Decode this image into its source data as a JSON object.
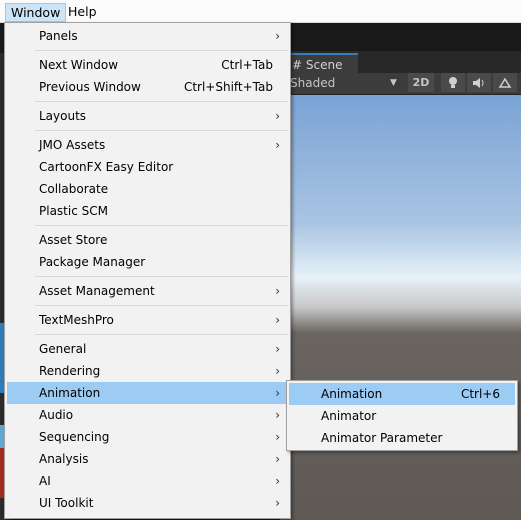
{
  "menubar": {
    "window": "Window",
    "help": "Help"
  },
  "scene": {
    "tab_label": "# Scene",
    "shading": "Shaded",
    "dropdown_arrow": "▼",
    "mode_2d": "2D",
    "light_icon": "light-bulb-icon",
    "audio_icon": "audio-icon",
    "effects_icon": "effects-icon"
  },
  "window_menu": {
    "items": [
      {
        "label": "Panels",
        "shortcut": "",
        "submenu": true
      },
      {
        "label": "Next Window",
        "shortcut": "Ctrl+Tab",
        "submenu": false
      },
      {
        "label": "Previous Window",
        "shortcut": "Ctrl+Shift+Tab",
        "submenu": false
      },
      {
        "label": "Layouts",
        "shortcut": "",
        "submenu": true
      },
      {
        "label": "JMO Assets",
        "shortcut": "",
        "submenu": true
      },
      {
        "label": "CartoonFX Easy Editor",
        "shortcut": "",
        "submenu": false
      },
      {
        "label": "Collaborate",
        "shortcut": "",
        "submenu": false
      },
      {
        "label": "Plastic SCM",
        "shortcut": "",
        "submenu": false
      },
      {
        "label": "Asset Store",
        "shortcut": "",
        "submenu": false
      },
      {
        "label": "Package Manager",
        "shortcut": "",
        "submenu": false
      },
      {
        "label": "Asset Management",
        "shortcut": "",
        "submenu": true
      },
      {
        "label": "TextMeshPro",
        "shortcut": "",
        "submenu": true
      },
      {
        "label": "General",
        "shortcut": "",
        "submenu": true
      },
      {
        "label": "Rendering",
        "shortcut": "",
        "submenu": true
      },
      {
        "label": "Animation",
        "shortcut": "",
        "submenu": true,
        "highlighted": true
      },
      {
        "label": "Audio",
        "shortcut": "",
        "submenu": true
      },
      {
        "label": "Sequencing",
        "shortcut": "",
        "submenu": true
      },
      {
        "label": "Analysis",
        "shortcut": "",
        "submenu": true
      },
      {
        "label": "AI",
        "shortcut": "",
        "submenu": true
      },
      {
        "label": "UI Toolkit",
        "shortcut": "",
        "submenu": true
      }
    ],
    "arrow_glyph": "›"
  },
  "animation_submenu": {
    "items": [
      {
        "label": "Animation",
        "shortcut": "Ctrl+6",
        "highlighted": true
      },
      {
        "label": "Animator",
        "shortcut": ""
      },
      {
        "label": "Animator Parameter",
        "shortcut": ""
      }
    ]
  },
  "colors": {
    "highlight": "#9ccbf4",
    "menu_bg": "#f2f2f2",
    "editor_dark": "#191919"
  }
}
